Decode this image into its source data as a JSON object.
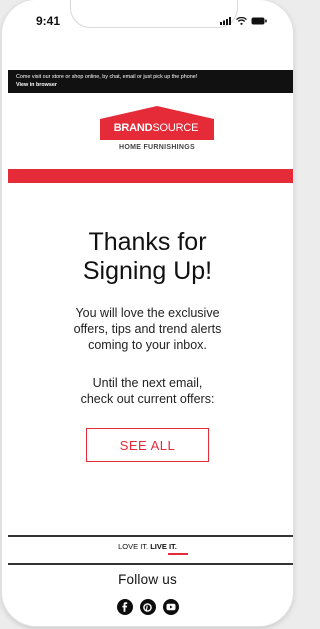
{
  "status_bar": {
    "time": "9:41"
  },
  "preheader": {
    "message": "Come visit our store or shop online, by chat, email or just pick up the phone!",
    "view_link": "View in browser"
  },
  "logo": {
    "brand_bold": "BRAND",
    "brand_light": "SOURCE",
    "tagline": "HOME FURNISHINGS"
  },
  "colors": {
    "accent": "#e52a38",
    "dark": "#111111"
  },
  "main": {
    "headline_line1": "Thanks for",
    "headline_line2": "Signing Up!",
    "para1_line1": "You will love the exclusive",
    "para1_line2": "offers, tips and trend alerts",
    "para1_line3": "coming to your inbox.",
    "para2_line1": "Until the next email,",
    "para2_line2": "check out current offers:",
    "cta_label": "SEE ALL"
  },
  "footer": {
    "slogan_part1": "LOVE IT. ",
    "slogan_part2": "LIVE IT.",
    "follow_label": "Follow us",
    "social": [
      "facebook-icon",
      "pinterest-icon",
      "youtube-icon"
    ]
  }
}
